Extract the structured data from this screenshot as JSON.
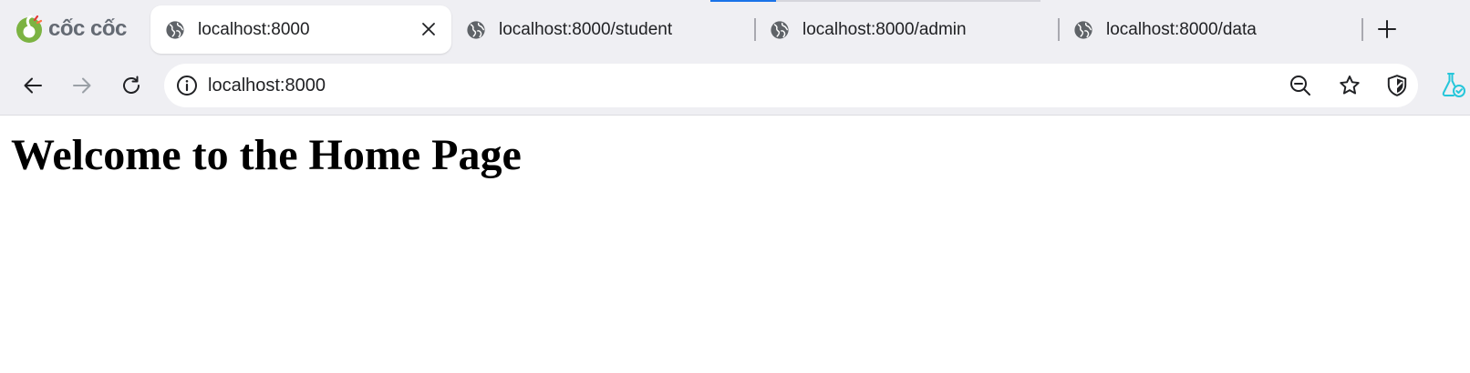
{
  "browser": {
    "logo_text": "cốc cốc",
    "colors": {
      "accent": "#1a73e8",
      "logo_green": "#7cb342",
      "logo_orange": "#ff7043",
      "logo_red": "#e53935",
      "extension_teal": "#26c6da",
      "chrome_bg": "#efeff3"
    }
  },
  "tabs": [
    {
      "title": "localhost:8000",
      "active": true,
      "icon": "globe-icon"
    },
    {
      "title": "localhost:8000/student",
      "active": false,
      "icon": "globe-icon"
    },
    {
      "title": "localhost:8000/admin",
      "active": false,
      "icon": "globe-icon"
    },
    {
      "title": "localhost:8000/data",
      "active": false,
      "icon": "globe-icon"
    }
  ],
  "toolbar": {
    "url": "localhost:8000",
    "icons": [
      "back-arrow-icon",
      "forward-arrow-icon",
      "reload-icon",
      "site-info-icon",
      "zoom-out-icon",
      "star-icon",
      "shield-icon",
      "extension-flask-icon"
    ]
  },
  "page": {
    "heading": "Welcome to the Home Page"
  }
}
